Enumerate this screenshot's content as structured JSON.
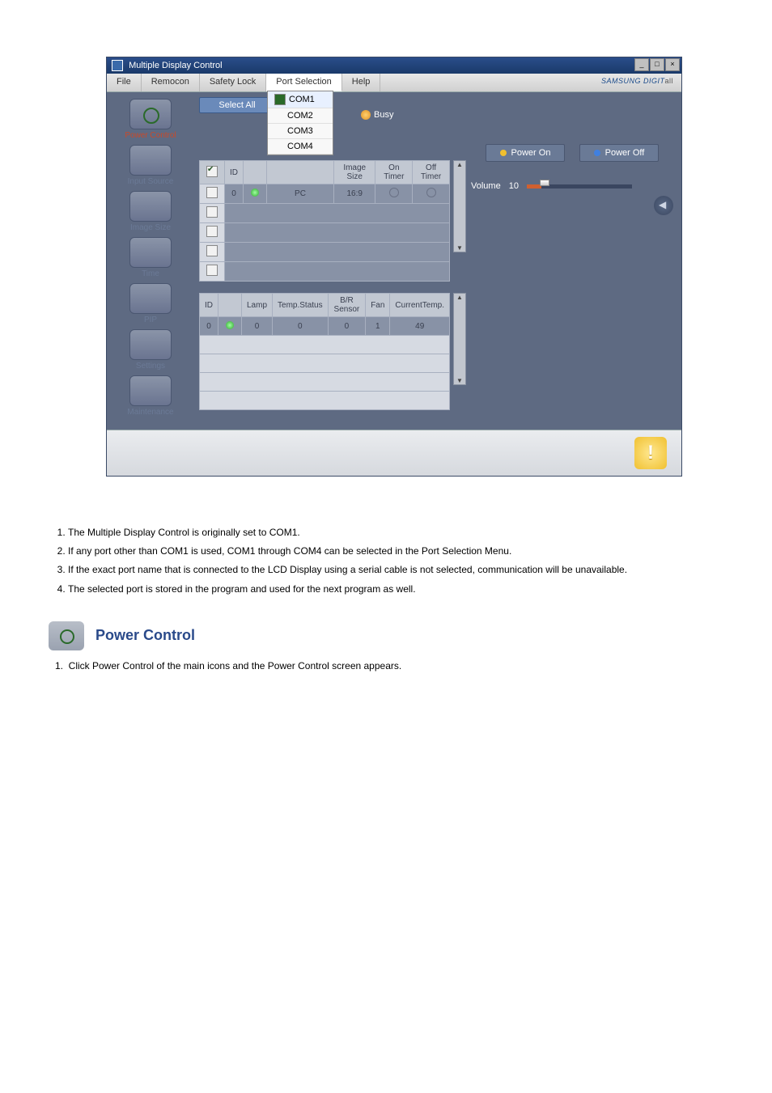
{
  "window": {
    "title": "Multiple Display Control",
    "min": "_",
    "max": "□",
    "close": "×"
  },
  "menubar": {
    "file": "File",
    "remocon": "Remocon",
    "safety_lock": "Safety Lock",
    "port_selection": "Port Selection",
    "help": "Help",
    "brand_a": "SAMSUNG",
    "brand_b": " DIGIT",
    "brand_c": "all"
  },
  "port_menu": {
    "items": [
      "COM1",
      "COM2",
      "COM3",
      "COM4"
    ],
    "selected_index": 0
  },
  "sidebar": {
    "items": [
      {
        "label": "Power Control"
      },
      {
        "label": "Input Source"
      },
      {
        "label": "Image Size"
      },
      {
        "label": "Time"
      },
      {
        "label": "PIP"
      },
      {
        "label": "Settings"
      },
      {
        "label": "Maintenance"
      }
    ]
  },
  "select_all": "Select All",
  "busy": "Busy",
  "upper_grid": {
    "headers": [
      "",
      "ID",
      "",
      "",
      "Image Size",
      "On Timer",
      "Off Timer"
    ],
    "row": {
      "id": "0",
      "source": "PC",
      "image_size": "16:9"
    }
  },
  "lower_grid": {
    "headers": [
      "ID",
      "",
      "Lamp",
      "Temp.Status",
      "B/R Sensor",
      "Fan",
      "CurrentTemp."
    ],
    "row": {
      "id": "0",
      "lamp": "0",
      "temp_status": "0",
      "br": "0",
      "fan": "1",
      "cur_temp": "49"
    }
  },
  "right": {
    "power_on": "Power On",
    "power_off": "Power Off",
    "volume_label": "Volume",
    "volume_value": "10"
  },
  "status_icon": "!",
  "doc": {
    "list": [
      "The Multiple Display Control is originally set to COM1.",
      "If any port other than COM1 is used, COM1 through COM4 can be selected in the Port Selection Menu.",
      "If the exact port name that is connected to the LCD Display using a serial cable is not selected, communication will be unavailable.",
      "The selected port is stored in the program and used for the next program as well."
    ],
    "section_title": "Power Control",
    "step1": "1.  Click Power Control of the main icons and the Power Control screen appears."
  }
}
